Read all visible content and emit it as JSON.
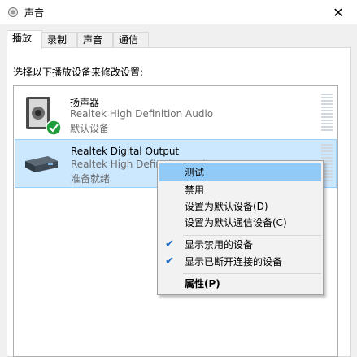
{
  "window": {
    "title": "声音",
    "close_glyph": "✕"
  },
  "tabs": [
    {
      "label": "播放",
      "active": true
    },
    {
      "label": "录制",
      "active": false
    },
    {
      "label": "声音",
      "active": false
    },
    {
      "label": "通信",
      "active": false
    }
  ],
  "instruction": "选择以下播放设备来修改设置:",
  "devices": [
    {
      "name": "扬声器",
      "driver": "Realtek High Definition Audio",
      "status": "默认设备",
      "icon": "speaker-icon",
      "badge": "default-check-icon"
    },
    {
      "name": "Realtek Digital Output",
      "driver": "Realtek High Definition Audio",
      "status": "准备就绪",
      "icon": "digital-output-icon",
      "selected": true
    }
  ],
  "context_menu": {
    "items": [
      {
        "label": "测试",
        "highlighted": true
      },
      {
        "label": "禁用"
      },
      {
        "label": "设置为默认设备(D)"
      },
      {
        "label": "设置为默认通信设备(C)"
      },
      {
        "label": "显示禁用的设备",
        "checked": true
      },
      {
        "label": "显示已断开连接的设备",
        "checked": true
      },
      {
        "label": "属性(P)",
        "bold": true
      }
    ]
  },
  "colors": {
    "selection": "#cce8ff",
    "menu_highlight": "#91c9f7",
    "check_green": "#1e9e3b"
  }
}
